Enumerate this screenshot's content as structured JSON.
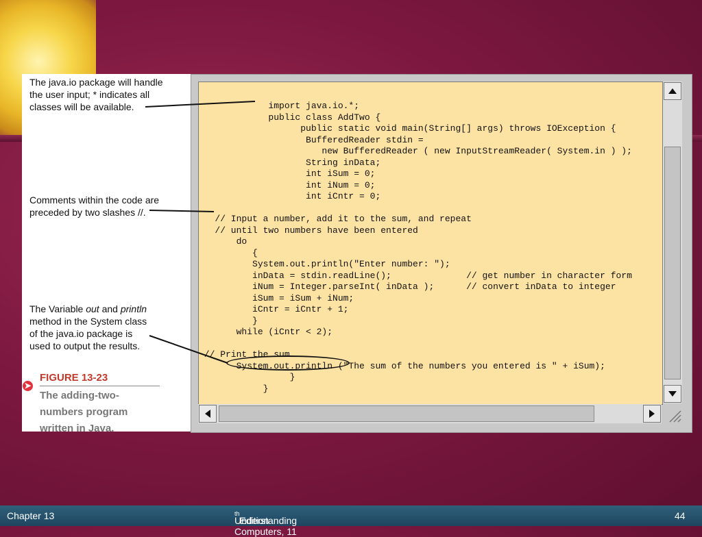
{
  "callouts": {
    "io_package": [
      "The java.io package will handle",
      "the user input; * indicates all",
      "classes will be available."
    ],
    "comments": [
      "Comments within the code are",
      "preceded by two slashes //."
    ],
    "variable": {
      "line1_a": "The Variable ",
      "line1_out": "out",
      "line1_b": " and ",
      "line1_println": "println",
      "line2": "method in the System class",
      "line3": "of the java.io package is",
      "line4": "used to output the results."
    }
  },
  "figure": {
    "number": "FIGURE 13-23",
    "title_lines": [
      "The adding-two-",
      "numbers program",
      "written in Java."
    ]
  },
  "code": "             import java.io.*;\n             public class AddTwo {\n                   public static void main(String[] args) throws IOException {\n                    BufferedReader stdin =\n                       new BufferedReader ( new InputStreamReader( System.in ) );\n                    String inData;\n                    int iSum = 0;\n                    int iNum = 0;\n                    int iCntr = 0;\n\n   // Input a number, add it to the sum, and repeat\n   // until two numbers have been entered\n       do\n          {\n          System.out.println(\"Enter number: \");\n          inData = stdin.readLine();              // get number in character form\n          iNum = Integer.parseInt( inData );      // convert inData to integer\n          iSum = iSum + iNum;\n          iCntr = iCntr + 1;\n          }\n       while (iCntr < 2);\n\n // Print the sum\n       System.out.println (\"The sum of the numbers you entered is \" + iSum);\n                 }\n            }",
  "footer": {
    "chapter": "Chapter 13",
    "title_pre": "Understanding Computers, 11",
    "title_sup": "th",
    "title_post": " Edition",
    "page": "44"
  },
  "colors": {
    "background": "#7d1840",
    "code_bg": "#fde3a3",
    "footer": "#2a5672",
    "figure_red": "#c0392b"
  },
  "icons": [
    "scroll-up-arrow-icon",
    "scroll-down-arrow-icon",
    "scroll-left-arrow-icon",
    "scroll-right-arrow-icon",
    "resize-grip-icon"
  ]
}
